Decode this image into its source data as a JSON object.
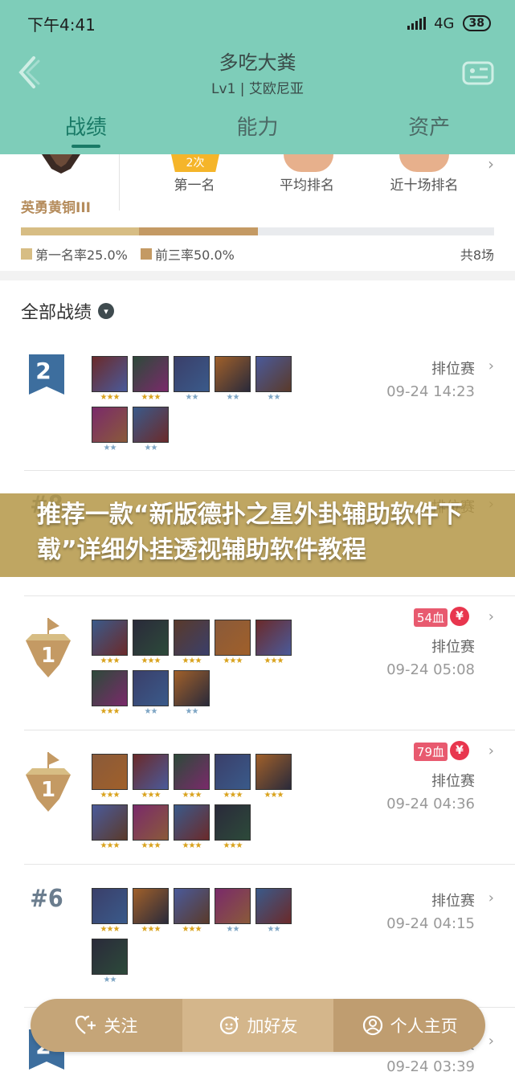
{
  "status_bar": {
    "time": "下午4:41",
    "network": "4G",
    "battery": "38"
  },
  "header": {
    "title": "多吃大粪",
    "subtitle": "Lv1 | 艾欧尼亚"
  },
  "tabs": [
    {
      "label": "战绩",
      "active": true
    },
    {
      "label": "能力",
      "active": false
    },
    {
      "label": "资产",
      "active": false
    }
  ],
  "summary": {
    "rank_name": "英勇黄铜III",
    "first_count_badge": "2次",
    "stats": [
      "第一名",
      "平均排名",
      "近十场排名"
    ],
    "first_rate": 0.25,
    "top3_rate": 0.5,
    "first_rate_label": "第一名率25.0%",
    "top3_rate_label": "前三率50.0%",
    "total_label": "共8场"
  },
  "list": {
    "title": "全部战绩",
    "matches": [
      {
        "place": "2",
        "mode": "排位赛",
        "time": "09-24 14:23",
        "champs": [
          "gold3",
          "gold3",
          "silver2",
          "silver2",
          "silver2",
          "silver2",
          "silver2",
          "none"
        ]
      },
      {
        "place": "#8",
        "mode": "排位赛",
        "time": "",
        "champs": []
      },
      {
        "place": "1",
        "blood": "54血",
        "mode": "排位赛",
        "time": "09-24 05:08",
        "champs": [
          "gold3",
          "gold3",
          "gold3",
          "gold3",
          "gold3",
          "gold3",
          "silver2",
          "silver2",
          "none"
        ]
      },
      {
        "place": "1",
        "blood": "79血",
        "mode": "排位赛",
        "time": "09-24 04:36",
        "champs": [
          "gold3",
          "gold3",
          "gold3",
          "gold3",
          "gold3",
          "gold3",
          "gold3",
          "gold3",
          "gold3"
        ]
      },
      {
        "place": "#6",
        "mode": "排位赛",
        "time": "09-24 04:15",
        "champs": [
          "gold3",
          "gold3",
          "gold3",
          "silver2",
          "silver2",
          "silver2"
        ]
      },
      {
        "place": "2",
        "mode": "排位赛",
        "time": "09-24 03:39",
        "champs": []
      }
    ]
  },
  "banner": {
    "text": "推荐一款“新版德扑之星外卦辅助软件下载”详细外挂透视辅助软件教程"
  },
  "actions": [
    {
      "label": "关注",
      "icon": "heart-plus-icon"
    },
    {
      "label": "加好友",
      "icon": "add-friend-icon"
    },
    {
      "label": "个人主页",
      "icon": "profile-icon"
    }
  ],
  "colors": {
    "header_bg": "#7ecdb9",
    "tab_active": "#197a66",
    "blood_badge": "#e85a6f",
    "yen_badge": "#e8364e",
    "first_bar": "#d7bd84",
    "top3_bar": "#c49a64"
  }
}
